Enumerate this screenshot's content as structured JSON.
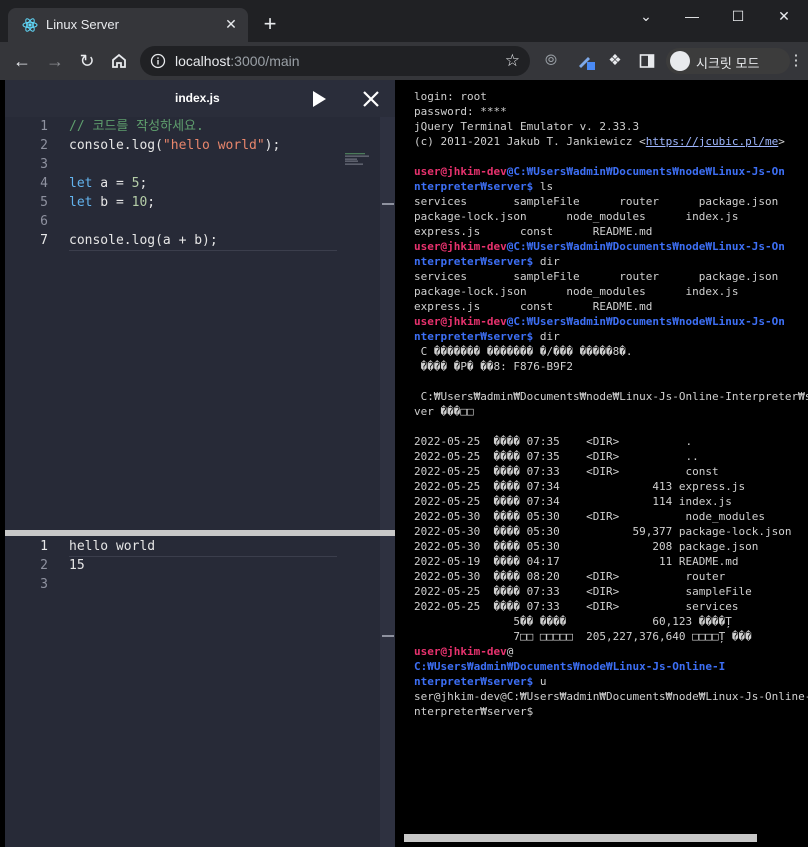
{
  "browser": {
    "tab_title": "Linux Server",
    "tab_close": "✕",
    "new_tab": "+",
    "url_host": "localhost",
    "url_path": ":3000/main",
    "incognito_label": "시크릿 모드",
    "window_controls": [
      "⌄",
      "—",
      "☐",
      "✕"
    ]
  },
  "editor": {
    "file_name": "index.js",
    "active_line": 7,
    "lines": [
      {
        "n": "1",
        "html": "<span class=\"tok-comment\">// 코드를 작성하세요.</span>"
      },
      {
        "n": "2",
        "html": "console.log(<span class=\"tok-string\">\"hello world\"</span>);"
      },
      {
        "n": "3",
        "html": ""
      },
      {
        "n": "4",
        "html": "<span class=\"tok-kw\">let</span> a = <span class=\"tok-num\">5</span>;"
      },
      {
        "n": "5",
        "html": "<span class=\"tok-kw\">let</span> b = <span class=\"tok-num\">10</span>;"
      },
      {
        "n": "6",
        "html": ""
      },
      {
        "n": "7",
        "html": "console.log(a + b);"
      }
    ]
  },
  "output": {
    "lines": [
      {
        "n": "1",
        "text": "hello world"
      },
      {
        "n": "2",
        "text": "15"
      },
      {
        "n": "3",
        "text": ""
      }
    ]
  },
  "terminal": {
    "lines": [
      {
        "html": "login: root"
      },
      {
        "html": "password: ****"
      },
      {
        "html": "jQuery Terminal Emulator v. 2.33.3"
      },
      {
        "html": "(c) 2011-2021 Jakub T. Jankiewicz &lt;<span class=\"t-link\">https://jcubic.pl/me</span>&gt;"
      },
      {
        "html": ""
      },
      {
        "html": "<span class=\"t-user\">user@jhkim-dev</span><span class=\"t-path\">@C:₩Users₩admin₩Documents₩node₩Linux-Js-On</span>"
      },
      {
        "html": "<span class=\"t-path\">nterpreter₩server$</span> ls"
      },
      {
        "html": "services       sampleFile      router      package.json"
      },
      {
        "html": "package-lock.json      node_modules      index.js"
      },
      {
        "html": "express.js      const      README.md"
      },
      {
        "html": "<span class=\"t-user\">user@jhkim-dev</span><span class=\"t-path\">@C:₩Users₩admin₩Documents₩node₩Linux-Js-On</span>"
      },
      {
        "html": "<span class=\"t-path\">nterpreter₩server$</span> dir"
      },
      {
        "html": "services       sampleFile      router      package.json"
      },
      {
        "html": "package-lock.json      node_modules      index.js"
      },
      {
        "html": "express.js      const      README.md"
      },
      {
        "html": "<span class=\"t-user\">user@jhkim-dev</span><span class=\"t-path\">@C:₩Users₩admin₩Documents₩node₩Linux-Js-On</span>"
      },
      {
        "html": "<span class=\"t-path\">nterpreter₩server$</span> dir"
      },
      {
        "html": " C ������� ������� �/��� �����8�."
      },
      {
        "html": " ���� �P� ��8: F876-B9F2"
      },
      {
        "html": ""
      },
      {
        "html": " C:₩Users₩admin₩Documents₩node₩Linux-Js-Online-Interpreter₩ser"
      },
      {
        "html": "ver ���□□"
      },
      {
        "html": ""
      },
      {
        "html": "2022-05-25  ���� 07:35    &lt;DIR&gt;          ."
      },
      {
        "html": "2022-05-25  ���� 07:35    &lt;DIR&gt;          .."
      },
      {
        "html": "2022-05-25  ���� 07:33    &lt;DIR&gt;          const"
      },
      {
        "html": "2022-05-25  ���� 07:34              413 express.js"
      },
      {
        "html": "2022-05-25  ���� 07:34              114 index.js"
      },
      {
        "html": "2022-05-30  ���� 05:30    &lt;DIR&gt;          node_modules"
      },
      {
        "html": "2022-05-30  ���� 05:30           59,377 package-lock.json"
      },
      {
        "html": "2022-05-30  ���� 05:30              208 package.json"
      },
      {
        "html": "2022-05-19  ���� 04:17               11 README.md"
      },
      {
        "html": "2022-05-30  ���� 08:20    &lt;DIR&gt;          router"
      },
      {
        "html": "2022-05-25  ���� 07:33    &lt;DIR&gt;          sampleFile"
      },
      {
        "html": "2022-05-25  ���� 07:33    &lt;DIR&gt;          services"
      },
      {
        "html": "               5�� ����             60,123 ����Ț"
      },
      {
        "html": "               7□□ □□□□□  205,227,376,640 □□□□Ț ���"
      },
      {
        "html": "<span class=\"t-user\">user@jhkim-dev</span>@"
      },
      {
        "html": "<span class=\"t-path\">C:₩Users₩admin₩Documents₩node₩Linux-Js-Online-I</span>"
      },
      {
        "html": "<span class=\"t-path\">nterpreter₩server$</span> u"
      },
      {
        "html": "ser@jhkim-dev@C:₩Users₩admin₩Documents₩node₩Linux-Js-Online-I"
      },
      {
        "html": "nterpreter₩server$"
      }
    ]
  }
}
